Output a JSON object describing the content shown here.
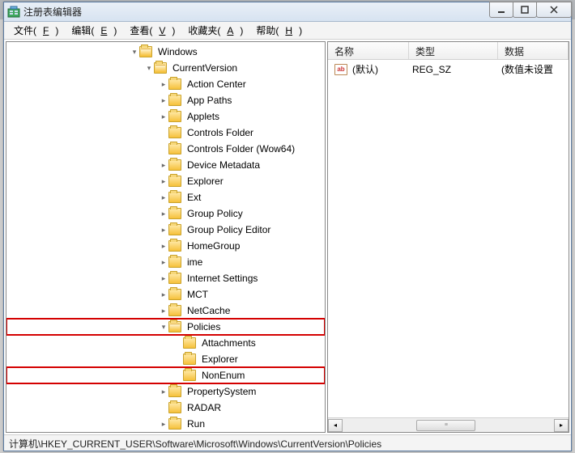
{
  "window": {
    "title": "注册表编辑器"
  },
  "menubar": [
    {
      "label": "文件",
      "hotkey": "F"
    },
    {
      "label": "编辑",
      "hotkey": "E"
    },
    {
      "label": "查看",
      "hotkey": "V"
    },
    {
      "label": "收藏夹",
      "hotkey": "A"
    },
    {
      "label": "帮助",
      "hotkey": "H"
    }
  ],
  "tree": [
    {
      "indent": 4,
      "twisty": "▾",
      "icon": "open",
      "label": "Windows"
    },
    {
      "indent": 5,
      "twisty": "▾",
      "icon": "open",
      "label": "CurrentVersion"
    },
    {
      "indent": 6,
      "twisty": "▸",
      "icon": "closed",
      "label": "Action Center"
    },
    {
      "indent": 6,
      "twisty": "▸",
      "icon": "closed",
      "label": "App Paths"
    },
    {
      "indent": 6,
      "twisty": "▸",
      "icon": "closed",
      "label": "Applets"
    },
    {
      "indent": 6,
      "twisty": "",
      "icon": "closed",
      "label": "Controls Folder"
    },
    {
      "indent": 6,
      "twisty": "",
      "icon": "closed",
      "label": "Controls Folder (Wow64)"
    },
    {
      "indent": 6,
      "twisty": "▸",
      "icon": "closed",
      "label": "Device Metadata"
    },
    {
      "indent": 6,
      "twisty": "▸",
      "icon": "closed",
      "label": "Explorer"
    },
    {
      "indent": 6,
      "twisty": "▸",
      "icon": "closed",
      "label": "Ext"
    },
    {
      "indent": 6,
      "twisty": "▸",
      "icon": "closed",
      "label": "Group Policy"
    },
    {
      "indent": 6,
      "twisty": "▸",
      "icon": "closed",
      "label": "Group Policy Editor"
    },
    {
      "indent": 6,
      "twisty": "▸",
      "icon": "closed",
      "label": "HomeGroup"
    },
    {
      "indent": 6,
      "twisty": "▸",
      "icon": "closed",
      "label": "ime"
    },
    {
      "indent": 6,
      "twisty": "▸",
      "icon": "closed",
      "label": "Internet Settings"
    },
    {
      "indent": 6,
      "twisty": "▸",
      "icon": "closed",
      "label": "MCT"
    },
    {
      "indent": 6,
      "twisty": "▸",
      "icon": "closed",
      "label": "NetCache"
    },
    {
      "indent": 6,
      "twisty": "▾",
      "icon": "open",
      "label": "Policies",
      "highlight": true
    },
    {
      "indent": 7,
      "twisty": "",
      "icon": "closed",
      "label": "Attachments"
    },
    {
      "indent": 7,
      "twisty": "",
      "icon": "closed",
      "label": "Explorer"
    },
    {
      "indent": 7,
      "twisty": "",
      "icon": "closed",
      "label": "NonEnum",
      "highlight": true
    },
    {
      "indent": 6,
      "twisty": "▸",
      "icon": "closed",
      "label": "PropertySystem"
    },
    {
      "indent": 6,
      "twisty": "",
      "icon": "closed",
      "label": "RADAR"
    },
    {
      "indent": 6,
      "twisty": "▸",
      "icon": "closed",
      "label": "Run"
    }
  ],
  "list": {
    "columns": {
      "name": "名称",
      "type": "类型",
      "data": "数据"
    },
    "rows": [
      {
        "name": "(默认)",
        "type": "REG_SZ",
        "data": "(数值未设置"
      }
    ]
  },
  "statusbar": "计算机\\HKEY_CURRENT_USER\\Software\\Microsoft\\Windows\\CurrentVersion\\Policies",
  "string_icon_text": "ab"
}
